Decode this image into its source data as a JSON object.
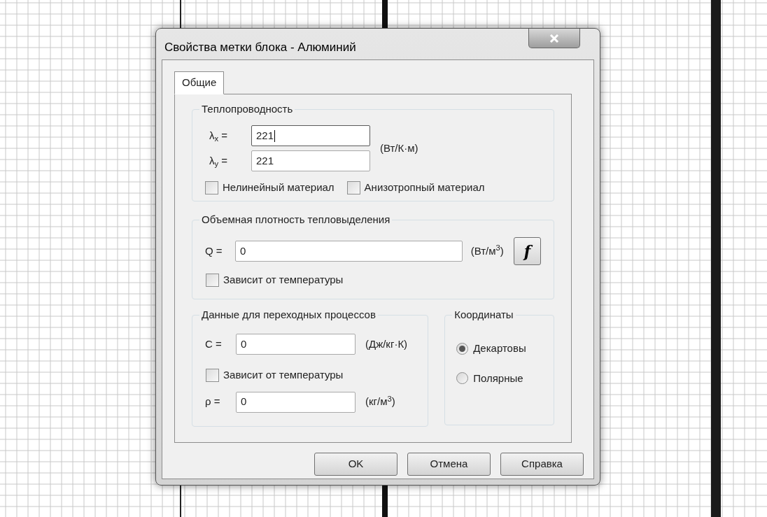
{
  "window": {
    "title": "Свойства метки блока - Алюминий"
  },
  "tabs": [
    {
      "label": "Общие",
      "selected": true
    }
  ],
  "conductivity": {
    "title": "Теплопроводность",
    "unit": "(Вт/К·м)",
    "fields": [
      {
        "label": "λ$_{x}$ =",
        "value": "221",
        "focused": true
      },
      {
        "label": "λ$_{y}$ =",
        "value": "221",
        "focused": false
      }
    ],
    "checkboxes": [
      {
        "label": "Нелинейный материал",
        "checked": false
      },
      {
        "label": "Анизотропный материал",
        "checked": false
      }
    ]
  },
  "heat": {
    "title": "Объемная плотность тепловыделения",
    "label": "Q =",
    "value": "0",
    "unit": "(Вт/м$^{3}$)",
    "function_button": "f",
    "checkbox": {
      "label": "Зависит от температуры",
      "checked": false
    }
  },
  "transient": {
    "title": "Данные для переходных процессов",
    "c": {
      "label": "C =",
      "value": "0",
      "unit": "(Дж/кг·К)"
    },
    "checkbox": {
      "label": "Зависит от температуры",
      "checked": false
    },
    "rho": {
      "label": "ρ =",
      "value": "0",
      "unit": "(кг/м$^{3}$)"
    }
  },
  "coordinates": {
    "title": "Координаты",
    "options": [
      {
        "label": "Декартовы",
        "selected": true
      },
      {
        "label": "Полярные",
        "selected": false
      }
    ]
  },
  "buttons": [
    "OK",
    "Отмена",
    "Справка"
  ]
}
